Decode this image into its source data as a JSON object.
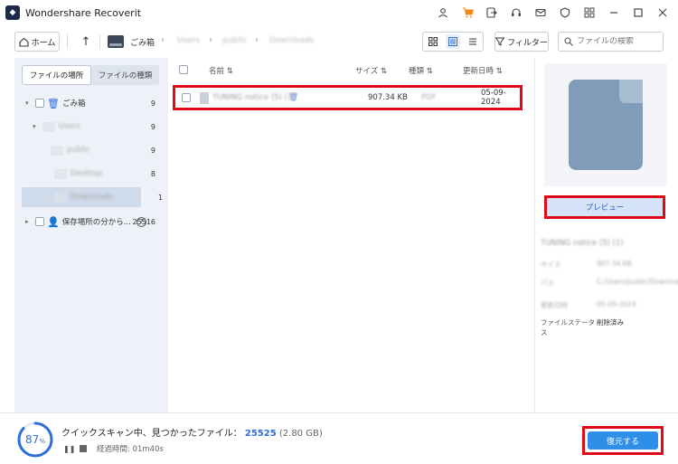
{
  "app": {
    "title": "Wondershare Recoverit",
    "logo": "◆",
    "title_icons": [
      "user-icon",
      "cart-icon",
      "sign-out-icon",
      "headset-icon",
      "mail-icon",
      "shield-icon",
      "grid-menu-icon",
      "minimize-icon",
      "maximize-icon",
      "close-icon"
    ]
  },
  "toolbar": {
    "home_label": "ホーム",
    "crumbs": [
      "ごみ箱",
      "Users",
      "public",
      "Downloads"
    ],
    "filter_label": "フィルター",
    "search_placeholder": "ファイルの検索"
  },
  "sidebar": {
    "tabs": [
      "ファイルの場所",
      "ファイルの種類"
    ],
    "active_tab": 0,
    "tree": [
      {
        "label": "ごみ箱",
        "count": "9"
      },
      {
        "label": "Users",
        "count": "9"
      },
      {
        "label": "public",
        "count": "9"
      },
      {
        "label": "Desktop",
        "count": "8"
      },
      {
        "label": "Downloads",
        "count": "1"
      },
      {
        "label": "保存場所の分から...",
        "count": "25516"
      }
    ]
  },
  "list": {
    "headers": {
      "name": "名前",
      "size": "サイズ",
      "type": "種類",
      "date": "更新日時"
    },
    "rows": [
      {
        "name": "TUNING notice (5) (1)",
        "size": "907.34 KB",
        "type": "PDF",
        "date": "05-09-2024"
      }
    ]
  },
  "details": {
    "preview_label": "プレビュー",
    "file_title": "TUNING notice (5) (1)",
    "fields": [
      {
        "key": "サイズ",
        "value": "907.34 KB"
      },
      {
        "key": "パス",
        "value": "C:/Users/public/Downloads"
      },
      {
        "key": "更新日時",
        "value": "05-09-2024"
      },
      {
        "key": "ファイルステータス",
        "value": "削除済み"
      }
    ]
  },
  "status": {
    "progress_percent": 87,
    "scan_text": "クイックスキャン中、見つかったファイル：",
    "found_count": "25525",
    "found_size": "(2.80 GB)",
    "elapsed_label": "経過時間: 01m40s",
    "recover_label": "復元する",
    "accent": "#2f6fd6"
  }
}
